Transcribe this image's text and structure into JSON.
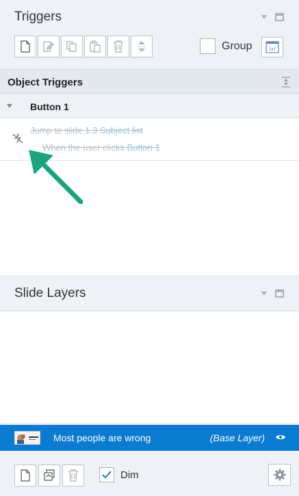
{
  "triggers_panel": {
    "title": "Triggers",
    "toolbar": {
      "new_icon": "new-trigger-icon",
      "edit_icon": "edit-trigger-icon",
      "copy_icon": "copy-icon",
      "paste_icon": "paste-icon",
      "delete_icon": "trash-icon",
      "move_icon": "move-up-down-icon"
    },
    "group_label": "Group",
    "group_checked": false,
    "variables_icon": "variables-icon"
  },
  "object_triggers": {
    "title": "Object Triggers",
    "object_name": "Button 1",
    "trigger": {
      "action_text": "Jump to slide",
      "target": "1.3 Subject list",
      "condition_text": "When the user clicks",
      "condition_object": "Button 1",
      "disabled": true
    }
  },
  "slide_layers": {
    "title": "Slide Layers",
    "base_layer": {
      "name": "Most people are wrong",
      "tag": "(Base Layer)",
      "thumbnail_icon": "slide-thumbnail"
    },
    "dim_label": "Dim",
    "dim_checked": true
  },
  "colors": {
    "accent": "#0a7bd1",
    "annotation_arrow": "#1aa57f",
    "disabled_text": "#b9bfc5",
    "disabled_link": "#93c1df"
  }
}
